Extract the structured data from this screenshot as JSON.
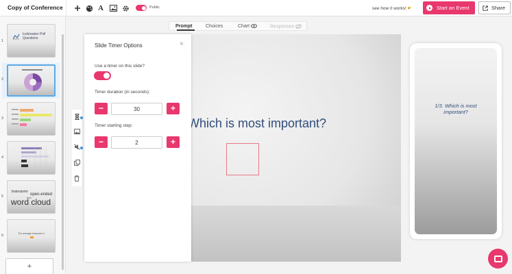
{
  "header": {
    "title": "Copy of Conference",
    "public_label": "Public",
    "see_how": "see how it works!",
    "start_event_label": "Start an Event",
    "share_label": "Share"
  },
  "sidebar": {
    "slides": [
      {
        "number": "1",
        "text": "Icebreaker Poll Questions"
      },
      {
        "number": "2",
        "text": ""
      },
      {
        "number": "3",
        "text": ""
      },
      {
        "number": "4",
        "text": ""
      },
      {
        "number": "5",
        "text": "word cloud",
        "words": [
          "brainstorm",
          "open-ended",
          "text"
        ]
      },
      {
        "number": "6",
        "text": "The average response is"
      }
    ],
    "add_slide_label": "+"
  },
  "tabs": [
    {
      "label": "Prompt",
      "state": "active"
    },
    {
      "label": "Choices",
      "state": "normal"
    },
    {
      "label": "Chart",
      "state": "normal",
      "icon": "eye-icon"
    },
    {
      "label": "Responses",
      "state": "disabled",
      "icon": "eye-off-icon"
    }
  ],
  "stage": {
    "title": "Which is most important?"
  },
  "modal": {
    "title": "Slide Timer Options",
    "close_label": "×",
    "timer_question": "Use a timer on this slide?",
    "timer_enabled": true,
    "duration_label": "Timer duration (in seconds):",
    "duration_value": "30",
    "step_label": "Timer starting step:",
    "step_value": "2",
    "minus_label": "−",
    "plus_label": "+"
  },
  "phone": {
    "question": "1/3. Which is most important?"
  },
  "colors": {
    "accent": "#e8386d",
    "title_blue": "#2f4c7a",
    "selection_blue": "#5aa9e6"
  }
}
